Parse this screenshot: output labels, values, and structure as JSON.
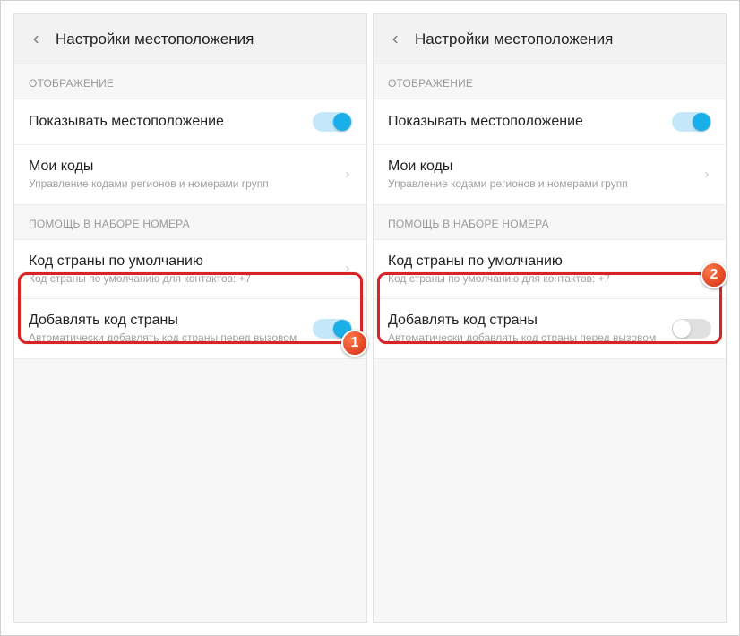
{
  "screen1": {
    "title": "Настройки местоположения",
    "section_display": "ОТОБРАЖЕНИЕ",
    "show_location": {
      "title": "Показывать местоположение",
      "on": true
    },
    "my_codes": {
      "title": "Мои коды",
      "sub": "Управление кодами регионов и номерами групп"
    },
    "section_dial": "ПОМОЩЬ В НАБОРЕ НОМЕРА",
    "default_code": {
      "title": "Код страны по умолчанию",
      "sub": "Код страны по умолчанию для контактов: +7"
    },
    "add_code": {
      "title": "Добавлять код страны",
      "sub": "Автоматически добавлять код страны перед вызовом",
      "on": true
    },
    "badge": "1"
  },
  "screen2": {
    "title": "Настройки местоположения",
    "section_display": "ОТОБРАЖЕНИЕ",
    "show_location": {
      "title": "Показывать местоположение",
      "on": true
    },
    "my_codes": {
      "title": "Мои коды",
      "sub": "Управление кодами регионов и номерами групп"
    },
    "section_dial": "ПОМОЩЬ В НАБОРЕ НОМЕРА",
    "default_code": {
      "title": "Код страны по умолчанию",
      "sub": "Код страны по умолчанию для контактов: +7"
    },
    "add_code": {
      "title": "Добавлять код страны",
      "sub": "Автоматически добавлять код страны перед вызовом",
      "on": false
    },
    "badge": "2"
  }
}
